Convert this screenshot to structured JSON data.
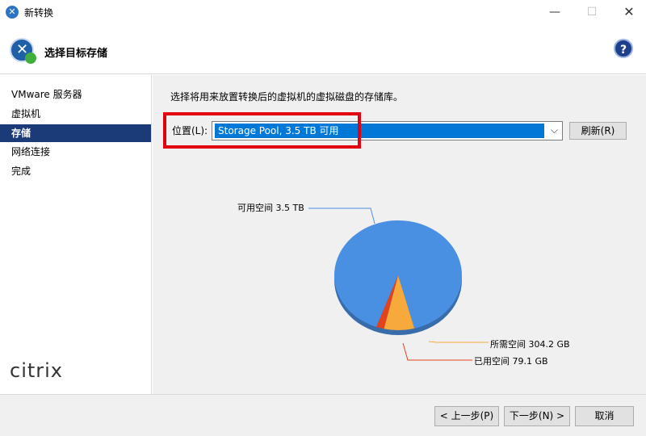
{
  "window": {
    "title": "新转换",
    "minimize": "—",
    "maximize": "☐",
    "close": "✕"
  },
  "header": {
    "title": "选择目标存储",
    "help": "?"
  },
  "sidebar": {
    "items": [
      {
        "label": "VMware 服务器",
        "active": false
      },
      {
        "label": "虚拟机",
        "active": false
      },
      {
        "label": "存储",
        "active": true
      },
      {
        "label": "网络连接",
        "active": false
      },
      {
        "label": "完成",
        "active": false
      }
    ],
    "brand": "citrix"
  },
  "main": {
    "description": "选择将用来放置转换后的虚拟机的虚拟磁盘的存储库。",
    "location_label": "位置(L):",
    "location_value": "Storage Pool, 3.5 TB 可用",
    "refresh_label": "刷新(R)"
  },
  "chart_data": {
    "type": "pie",
    "slices": [
      {
        "name": "可用空间",
        "label": "可用空间 3.5 TB",
        "value": 3584,
        "color": "#4a90e2"
      },
      {
        "name": "所需空间",
        "label": "所需空间 304.2 GB",
        "value": 304.2,
        "color": "#f7a93b"
      },
      {
        "name": "已用空间",
        "label": "已用空间 79.1 GB",
        "value": 79.1,
        "color": "#e2431e"
      }
    ]
  },
  "footer": {
    "back": "< 上一步(P)",
    "next": "下一步(N) >",
    "cancel": "取消"
  }
}
